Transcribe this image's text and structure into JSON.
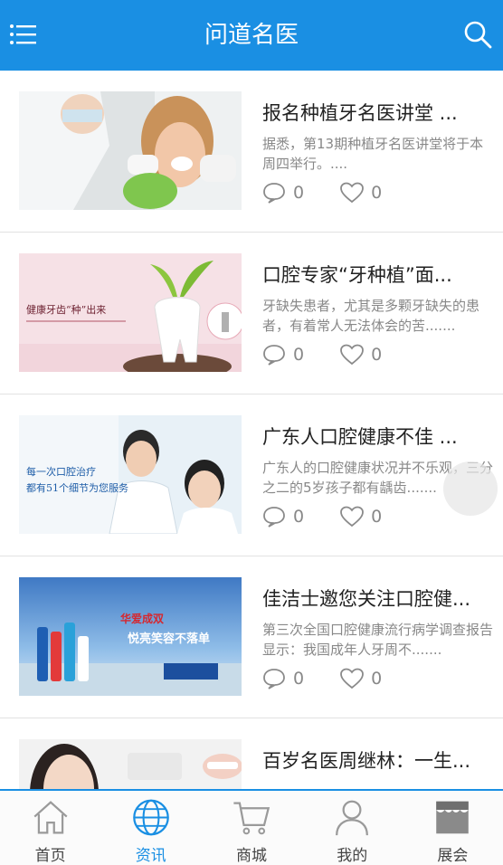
{
  "header": {
    "title": "问道名医",
    "menu_icon": "menu-icon",
    "search_icon": "search-icon"
  },
  "colors": {
    "primary": "#1a8fe3",
    "text": "#222222",
    "muted": "#888888",
    "divider": "#e2e2e2"
  },
  "articles": [
    {
      "title": "报名种植牙名医讲堂 ...",
      "desc": "据悉，第13期种植牙名医讲堂将于本周四举行。....",
      "comments": "0",
      "likes": "0",
      "image": "dentist-patient-photo"
    },
    {
      "title": "口腔专家“牙种植”面...",
      "desc": "牙缺失患者，尤其是多颗牙缺失的患者，有着常人无法体会的苦.......",
      "comments": "0",
      "likes": "0",
      "image": "healthy-tooth-banner",
      "image_text": "健康牙齿“种”出来"
    },
    {
      "title": "广东人口腔健康不佳 ...",
      "desc": "广东人的口腔健康状况并不乐观，三分之二的5岁孩子都有龋齿.......",
      "comments": "0",
      "likes": "0",
      "image": "dental-service-banner",
      "image_text_1": "每一次口腔治疗",
      "image_text_2": "都有51个细节为您服务"
    },
    {
      "title": "佳洁士邀您关注口腔健...",
      "desc": "第三次全国口腔健康流行病学调查报告显示：我国成年人牙周不.......",
      "comments": "0",
      "likes": "0",
      "image": "toothpaste-ad-banner",
      "image_text_1": "华爱成双",
      "image_text_2": "悦亮笑容不落单"
    },
    {
      "title": "百岁名医周继林：一生...",
      "desc": "",
      "comments": "",
      "likes": "",
      "image": "smile-photo"
    }
  ],
  "tabbar": {
    "items": [
      {
        "label": "首页",
        "icon": "home-icon"
      },
      {
        "label": "资讯",
        "icon": "globe-icon",
        "active": true
      },
      {
        "label": "商城",
        "icon": "cart-icon"
      },
      {
        "label": "我的",
        "icon": "user-icon"
      },
      {
        "label": "展会",
        "icon": "store-icon"
      }
    ]
  }
}
